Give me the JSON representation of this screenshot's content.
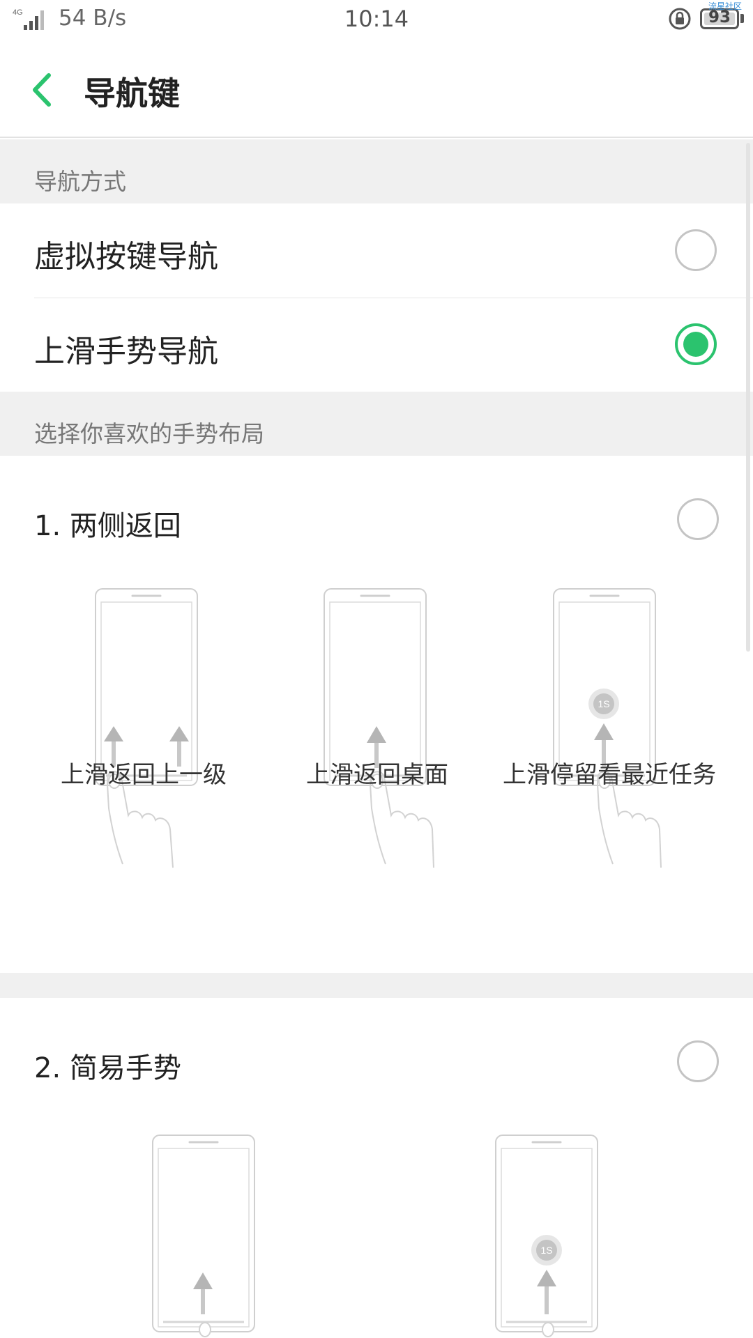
{
  "status_bar": {
    "network": "4G",
    "speed": "54 B/s",
    "time": "10:14",
    "battery": "93",
    "watermark": "流星社区"
  },
  "header": {
    "title": "导航键"
  },
  "nav_mode": {
    "section_label": "导航方式",
    "options": [
      {
        "label": "虚拟按键导航",
        "selected": false
      },
      {
        "label": "上滑手势导航",
        "selected": true
      }
    ]
  },
  "gesture_layout": {
    "section_label": "选择你喜欢的手势布局",
    "layouts": [
      {
        "title": "1. 两侧返回",
        "selected": false,
        "captions": [
          "上滑返回上一级",
          "上滑返回桌面",
          "上滑停留看最近任务"
        ]
      },
      {
        "title": "2. 简易手势",
        "selected": false
      }
    ]
  },
  "illustration": {
    "hold_badge": "1S"
  },
  "colors": {
    "accent": "#2bc36e",
    "section_bg": "#f0f0f0",
    "radio_border": "#c4c4c4"
  },
  "icons": {
    "back": "chevron-left-icon",
    "lock": "rotation-lock-icon",
    "battery": "battery-icon",
    "signal": "signal-icon"
  }
}
